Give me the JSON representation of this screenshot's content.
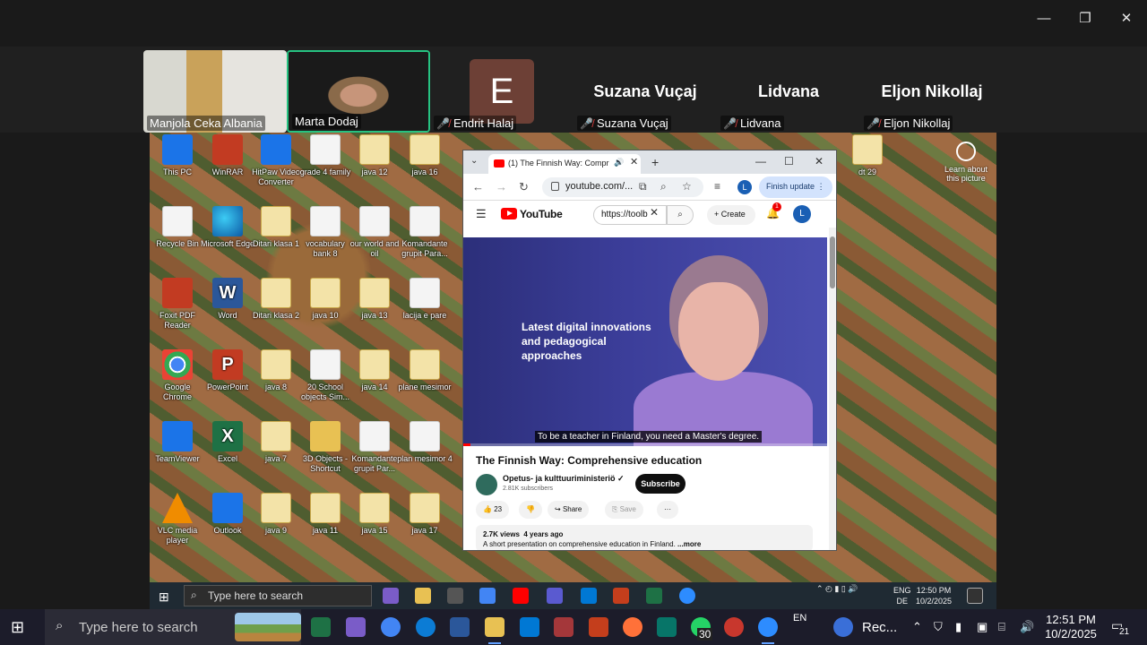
{
  "window_controls": {
    "minimize": "—",
    "maximize": "❐",
    "close": "✕"
  },
  "participants": [
    {
      "name": "Manjola Ceka Albania",
      "muted": false,
      "video": true
    },
    {
      "name": "Marta Dodaj",
      "muted": false,
      "video": true,
      "speaking": true
    },
    {
      "name": "Endrit Halaj",
      "muted": true,
      "avatar_letter": "E"
    },
    {
      "name": "Suzana Vuçaj",
      "muted": true,
      "display_name": "Suzana Vuçaj"
    },
    {
      "name": "Lidvana",
      "muted": true,
      "display_name": "Lidvana"
    },
    {
      "name": "Eljon Nikollaj",
      "muted": true,
      "display_name": "Eljon Nikollaj"
    }
  ],
  "shared_desktop": {
    "icons": [
      {
        "label": "This PC",
        "icon": "computer-icon"
      },
      {
        "label": "WinRAR",
        "icon": "winrar-icon"
      },
      {
        "label": "HitPaw Video Converter",
        "icon": "hitpaw-icon"
      },
      {
        "label": "grade 4 family",
        "icon": "word-doc-icon"
      },
      {
        "label": "java 12",
        "icon": "java-file-icon"
      },
      {
        "label": "java 16",
        "icon": "java-file-icon"
      },
      {
        "label": "Recycle Bin",
        "icon": "recycle-bin-icon"
      },
      {
        "label": "Microsoft Edge",
        "icon": "edge-icon"
      },
      {
        "label": "Ditari klasa 1",
        "icon": "java-file-icon"
      },
      {
        "label": "vocabulary bank 8",
        "icon": "word-doc-icon"
      },
      {
        "label": "our world and oil",
        "icon": "word-doc-icon"
      },
      {
        "label": "Komandante grupit Para...",
        "icon": "word-doc-icon"
      },
      {
        "label": "Foxit PDF Reader",
        "icon": "foxit-icon"
      },
      {
        "label": "Word",
        "icon": "word-icon"
      },
      {
        "label": "Ditari klasa 2",
        "icon": "java-file-icon"
      },
      {
        "label": "java 10",
        "icon": "java-file-icon"
      },
      {
        "label": "java 13",
        "icon": "java-file-icon"
      },
      {
        "label": "lacija e pare",
        "icon": "doc-icon"
      },
      {
        "label": "Google Chrome",
        "icon": "chrome-icon"
      },
      {
        "label": "PowerPoint",
        "icon": "powerpoint-icon"
      },
      {
        "label": "java 8",
        "icon": "java-file-icon"
      },
      {
        "label": "20 School objects Sim...",
        "icon": "word-doc-icon"
      },
      {
        "label": "java 14",
        "icon": "java-file-icon"
      },
      {
        "label": "plane mesimor",
        "icon": "java-file-icon"
      },
      {
        "label": "TeamViewer",
        "icon": "teamviewer-icon"
      },
      {
        "label": "Excel",
        "icon": "excel-icon"
      },
      {
        "label": "java 7",
        "icon": "java-file-icon"
      },
      {
        "label": "3D Objects - Shortcut",
        "icon": "folder-icon"
      },
      {
        "label": "Komandante grupit Par...",
        "icon": "word-doc-icon"
      },
      {
        "label": "plan mesimor 4",
        "icon": "spreadsheet-icon"
      },
      {
        "label": "VLC media player",
        "icon": "vlc-icon"
      },
      {
        "label": "Outlook",
        "icon": "outlook-icon"
      },
      {
        "label": "java 9",
        "icon": "java-file-icon"
      },
      {
        "label": "java 11",
        "icon": "java-file-icon"
      },
      {
        "label": "java 15",
        "icon": "java-file-icon"
      },
      {
        "label": "java 17",
        "icon": "java-file-icon"
      },
      {
        "label": "dt 29",
        "icon": "java-file-icon"
      }
    ],
    "learn_about": "Learn about this picture",
    "remote_taskbar": {
      "search_placeholder": "Type here to search",
      "lang_top": "ENG",
      "lang_bottom": "DE",
      "time": "12:50 PM",
      "date": "10/2/2025"
    }
  },
  "browser": {
    "tab_title": "(1) The Finnish Way: Compr",
    "url": "youtube.com/...",
    "finish_update": "Finish update",
    "profile_letter": "L"
  },
  "youtube": {
    "logo": "YouTube",
    "search_value": "https://toolb",
    "create_label": "Create",
    "notification_count": "1",
    "avatar_letter": "L",
    "video_overlay_text": "Latest digital innovations and pedagogical approaches",
    "caption": "To be a teacher in Finland, you need a Master's degree.",
    "progress_fraction": 0.02,
    "title": "The Finnish Way: Comprehensive education",
    "channel": "Opetus- ja kulttuuriministeriö",
    "subscribers": "2.81K subscribers",
    "subscribe_label": "Subscribe",
    "likes": "23",
    "share_label": "Share",
    "save_label": "Save",
    "more_actions": "···",
    "views": "2.7K views",
    "age": "4 years ago",
    "description": "A short presentation on comprehensive education in Finland.",
    "more_label": "...more"
  },
  "taskbar": {
    "search_placeholder": "Type here to search",
    "whatsapp_badge": "30",
    "language": "EN",
    "recording_label": "Rec...",
    "time": "12:51 PM",
    "date": "10/2/2025",
    "notification_count": "21"
  }
}
